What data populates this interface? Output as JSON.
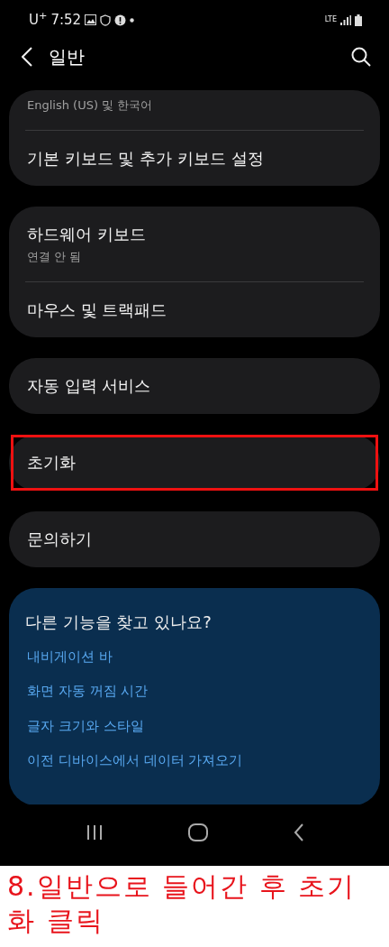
{
  "status_bar": {
    "carrier": "U$^{+}$",
    "time": "7:52",
    "network": "LTE"
  },
  "header": {
    "title": "일반"
  },
  "groups": [
    {
      "items": [
        {
          "subtitle": "English (US) 및 한국어",
          "highlighted": false
        },
        {
          "title": "기본 키보드 및 추가 키보드 설정",
          "highlighted": false
        }
      ]
    },
    {
      "items": [
        {
          "title": "하드웨어 키보드",
          "subtitle": "연결 안 됨",
          "highlighted": false
        },
        {
          "title": "마우스 및 트랙패드",
          "highlighted": false
        }
      ]
    },
    {
      "items": [
        {
          "title": "자동 입력 서비스",
          "highlighted": false
        }
      ]
    },
    {
      "items": [
        {
          "title": "초기화",
          "highlighted": true
        }
      ]
    },
    {
      "items": [
        {
          "title": "문의하기",
          "highlighted": false
        }
      ]
    }
  ],
  "suggestions": {
    "title": "다른 기능을 찾고 있나요?",
    "links": [
      "내비게이션 바",
      "화면 자동 꺼짐 시간",
      "글자 크기와 스타일",
      "이전 디바이스에서 데이터 가져오기"
    ]
  },
  "caption": "8.일반으로 들어간 후 초기화 클릭"
}
